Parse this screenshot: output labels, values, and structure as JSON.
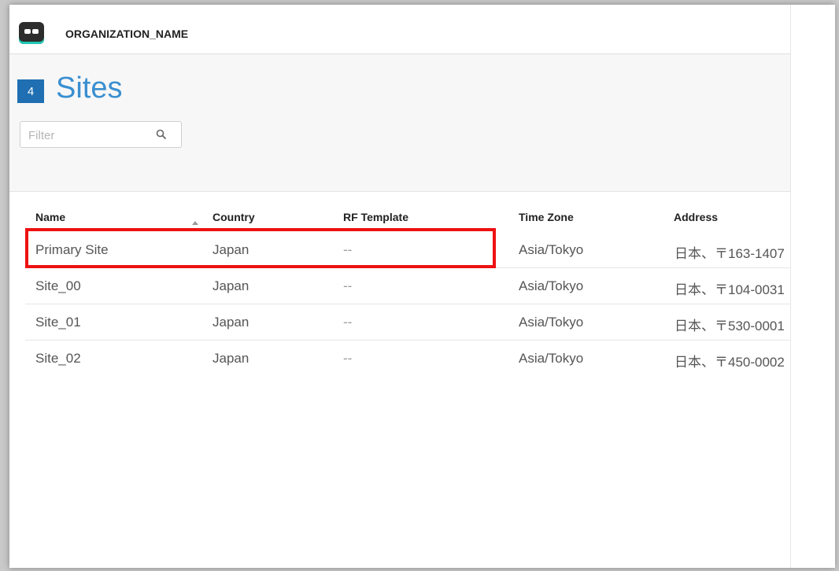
{
  "topbar": {
    "logo_icon": "robot-logo-icon",
    "org_name": "ORGANIZATION_NAME"
  },
  "page": {
    "count": "4",
    "title": "Sites"
  },
  "filter": {
    "placeholder": "Filter",
    "value": "",
    "icon": "search-icon"
  },
  "table": {
    "sorted_column": "Name",
    "headers": [
      "Name",
      "Country",
      "RF Template",
      "Time Zone",
      "Address"
    ],
    "rows": [
      {
        "name": "Primary Site",
        "country": "Japan",
        "rf_template": "--",
        "time_zone": "Asia/Tokyo",
        "address": "日本、〒163-1407"
      },
      {
        "name": "Site_00",
        "country": "Japan",
        "rf_template": "--",
        "time_zone": "Asia/Tokyo",
        "address": "日本、〒104-0031"
      },
      {
        "name": "Site_01",
        "country": "Japan",
        "rf_template": "--",
        "time_zone": "Asia/Tokyo",
        "address": "日本、〒530-0001"
      },
      {
        "name": "Site_02",
        "country": "Japan",
        "rf_template": "--",
        "time_zone": "Asia/Tokyo",
        "address": "日本、〒450-0002"
      }
    ]
  },
  "colors": {
    "accent": "#3a8fd0",
    "count_badge": "#1f6fb2",
    "highlight": "#ee1111"
  }
}
